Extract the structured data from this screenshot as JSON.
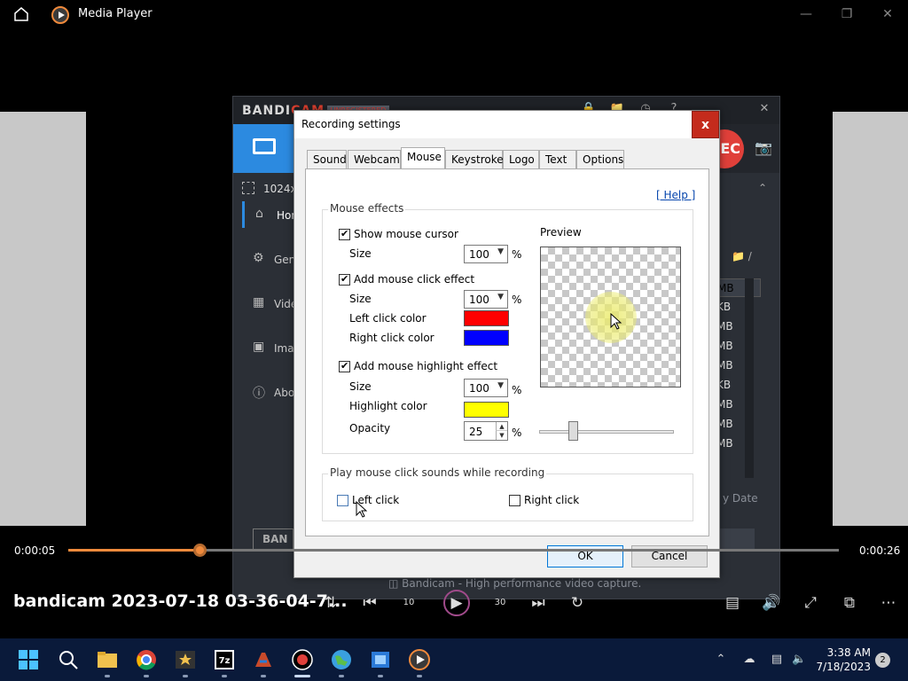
{
  "media_player": {
    "title": "Media Player",
    "elapsed": "0:00:05",
    "remaining": "0:00:26",
    "progress": 0.17,
    "file_title": "bandicam 2023-07-18 03-36-04-7...",
    "skip_back": "10",
    "skip_forward": "30"
  },
  "bandicam": {
    "logo_main": "BANDI",
    "logo_accent": "CAM",
    "badge": "UNREGISTERED",
    "resolution": "1024x7",
    "rec_label": "EC",
    "sidebar": [
      {
        "label": "Hom",
        "icon": "home-icon"
      },
      {
        "label": "Gen",
        "icon": "gear-icon"
      },
      {
        "label": "Vide",
        "icon": "video-icon"
      },
      {
        "label": "Ima",
        "icon": "image-icon"
      },
      {
        "label": "Abo",
        "icon": "info-icon"
      }
    ],
    "folder_label": "/",
    "file_sizes": [
      "MB",
      "KB",
      "MB",
      "MB",
      "MB",
      "KB",
      "MB",
      "MB",
      "MB"
    ],
    "sort_label": "y Date",
    "banner_label": "BAN",
    "right_button": "e",
    "footer": "Bandicam - High performance video capture."
  },
  "dialog": {
    "title": "Recording settings",
    "close": "x",
    "tabs": [
      "Sound",
      "Webcam",
      "Mouse",
      "Keystroke",
      "Logo",
      "Text",
      "Options"
    ],
    "active_tab": "Mouse",
    "help": "[ Help ]",
    "mouse_effects": {
      "group_label": "Mouse effects",
      "show_cursor": {
        "label": "Show mouse cursor",
        "checked": true,
        "size_label": "Size",
        "size": "100",
        "unit": "%"
      },
      "click_effect": {
        "label": "Add mouse click effect",
        "checked": true,
        "size_label": "Size",
        "size": "100",
        "unit": "%",
        "left_label": "Left click color",
        "left_color": "#ff0000",
        "right_label": "Right click color",
        "right_color": "#0000ff"
      },
      "highlight": {
        "label": "Add mouse highlight effect",
        "checked": true,
        "size_label": "Size",
        "size": "100",
        "unit": "%",
        "color_label": "Highlight color",
        "color": "#ffff00",
        "opacity_label": "Opacity",
        "opacity": "25",
        "opacity_unit": "%"
      },
      "preview_label": "Preview",
      "slider_value": 0.25
    },
    "sounds": {
      "group_label": "Play mouse click sounds while recording",
      "left": {
        "label": "Left click",
        "checked": false
      },
      "right": {
        "label": "Right click",
        "checked": false
      }
    },
    "ok": "OK",
    "cancel": "Cancel"
  },
  "taskbar": {
    "time": "3:38 AM",
    "date": "7/18/2023",
    "notifications": "2",
    "apps": [
      "windows-start-icon",
      "search-icon",
      "file-explorer-icon",
      "chrome-icon",
      "media-app-icon",
      "7zip-icon",
      "paint-icon",
      "bandicam-record-icon",
      "globe-icon",
      "film-icon",
      "media-player-icon"
    ]
  },
  "colors": {
    "accent_blue": "#2c8ae0",
    "record_red": "#e0403a",
    "seek_orange": "#f08a3c"
  }
}
